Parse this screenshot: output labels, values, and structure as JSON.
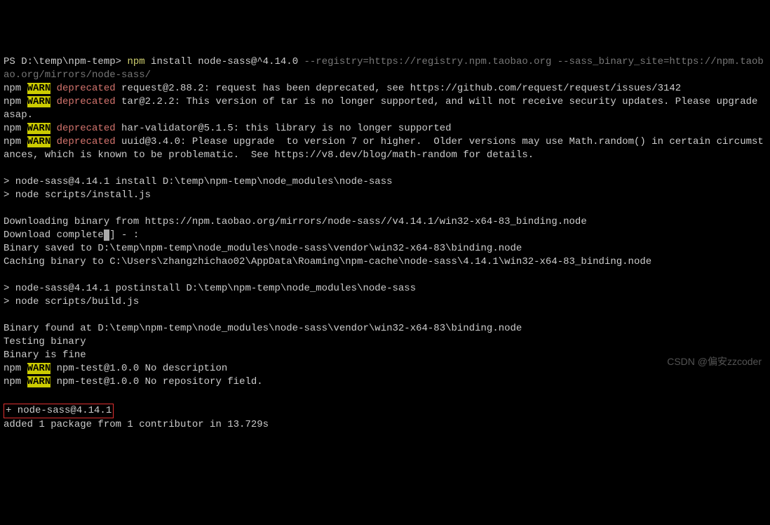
{
  "prompt_prefix": "PS D:\\temp\\npm-temp> ",
  "npm_word": "npm",
  "install_part": " install node-sass@^4.14.0 ",
  "registry_flags": "--registry=https://registry.npm.taobao.org --sass_binary_site=https://npm.taobao.org/mirrors/node-sass/",
  "warns": {
    "npm_prefix": "npm ",
    "warn": "WARN",
    "deprecated": " deprecated ",
    "line1": "request@2.88.2: request has been deprecated, see https://github.com/request/request/issues/3142",
    "line2": "tar@2.2.2: This version of tar is no longer supported, and will not receive security updates. Please upgrade asap.",
    "line3": "har-validator@5.1.5: this library is no longer supported",
    "line4": "uuid@3.4.0: Please upgrade  to version 7 or higher.  Older versions may use Math.random() in certain circumstances, which is known to be problematic.  See https://v8.dev/blog/math-random for details.",
    "line5": " npm-test@1.0.0 No description",
    "line6": " npm-test@1.0.0 No repository field."
  },
  "body": {
    "blank": " ",
    "install_hdr": "> node-sass@4.14.1 install D:\\temp\\npm-temp\\node_modules\\node-sass",
    "install_js": "> node scripts/install.js",
    "dl": "Downloading binary from https://npm.taobao.org/mirrors/node-sass//v4.14.1/win32-x64-83_binding.node",
    "dlcomplete_a": "Download complete",
    "dlcomplete_mid": " ",
    "dlcomplete_b": "] - :",
    "saved": "Binary saved to D:\\temp\\npm-temp\\node_modules\\node-sass\\vendor\\win32-x64-83\\binding.node",
    "caching": "Caching binary to C:\\Users\\zhangzhichao02\\AppData\\Roaming\\npm-cache\\node-sass\\4.14.1\\win32-x64-83_binding.node",
    "postinstall_hdr": "> node-sass@4.14.1 postinstall D:\\temp\\npm-temp\\node_modules\\node-sass",
    "build_js": "> node scripts/build.js",
    "found": "Binary found at D:\\temp\\npm-temp\\node_modules\\node-sass\\vendor\\win32-x64-83\\binding.node",
    "testing": "Testing binary",
    "fine": "Binary is fine"
  },
  "boxed": "+ node-sass@4.14.1",
  "added": "added 1 package from 1 contributor in 13.729s",
  "watermark": "CSDN @偏安zzcoder"
}
